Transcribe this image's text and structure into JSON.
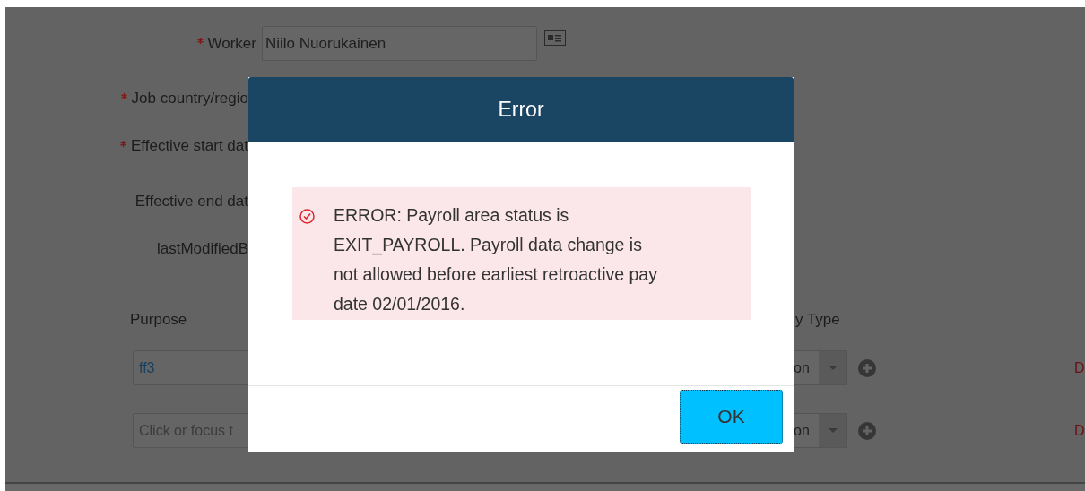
{
  "worker": {
    "label": "Worker",
    "required": true,
    "value": "Niilo Nuorukainen"
  },
  "fields": [
    {
      "label": "Job country/regio",
      "required": true
    },
    {
      "label": "Effective start dat",
      "required": true
    },
    {
      "label": "Effective end dat",
      "required": false
    },
    {
      "label": "lastModifiedB",
      "required": false
    }
  ],
  "table": {
    "columns": [
      "Purpose",
      "y Type"
    ],
    "rows": [
      {
        "purpose": {
          "value": "ff3"
        },
        "type": "on",
        "action": "D"
      },
      {
        "purpose": {
          "placeholder": "Click or focus t"
        },
        "type": "on",
        "action": "D"
      }
    ]
  },
  "dialog": {
    "title": "Error",
    "message": "ERROR: Payroll area status is EXIT_PAYROLL. Payroll data change is not allowed before earliest retroactive pay date 02/01/2016.",
    "button": "OK"
  }
}
